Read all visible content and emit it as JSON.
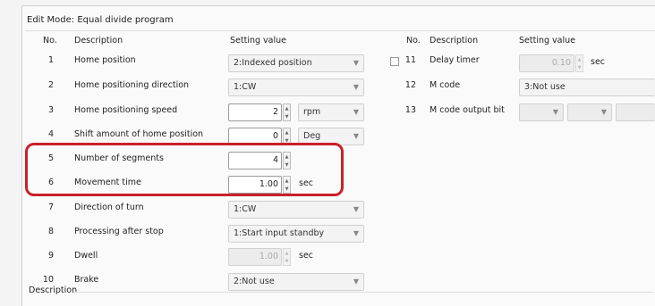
{
  "edit_mode": {
    "title": "Edit Mode:  Equal divide program"
  },
  "left_header": {
    "no": "No.",
    "description": "Description",
    "setting": "Setting value"
  },
  "right_header": {
    "no": "No.",
    "description": "Description",
    "setting": "Setting value"
  },
  "params": [
    {
      "no": "1",
      "description": "Home position",
      "value": "2:Indexed position"
    },
    {
      "no": "2",
      "description": "Home positioning direction",
      "value": "1:CW"
    },
    {
      "no": "3",
      "description": "Home positioning speed",
      "value": "2",
      "unit": "rpm"
    },
    {
      "no": "4",
      "description": "Shift amount of home position",
      "value": "0",
      "unit": "Deg"
    },
    {
      "no": "5",
      "description": "Number of segments",
      "value": "4"
    },
    {
      "no": "6",
      "description": "Movement time",
      "value": "1.00",
      "unit": "sec"
    },
    {
      "no": "7",
      "description": "Direction of turn",
      "value": "1:CW"
    },
    {
      "no": "8",
      "description": "Processing after stop",
      "value": "1:Start input standby"
    },
    {
      "no": "9",
      "description": "Dwell",
      "value": "1.00",
      "unit": "sec"
    },
    {
      "no": "10",
      "description": "Brake",
      "value": "2:Not use"
    }
  ],
  "right_params": [
    {
      "no": "11",
      "description": "Delay timer",
      "value": "0.10",
      "unit": "sec",
      "checked": false
    },
    {
      "no": "12",
      "description": "M code",
      "value": "3:Not use"
    },
    {
      "no": "13",
      "description": "M code output bit",
      "value": ""
    }
  ],
  "description_section": {
    "label": "Description"
  },
  "icons": {
    "dropdown": "chevron-down-icon",
    "spinner": "spin-arrows-icon"
  },
  "colors": {
    "highlight": "#c9202a"
  }
}
